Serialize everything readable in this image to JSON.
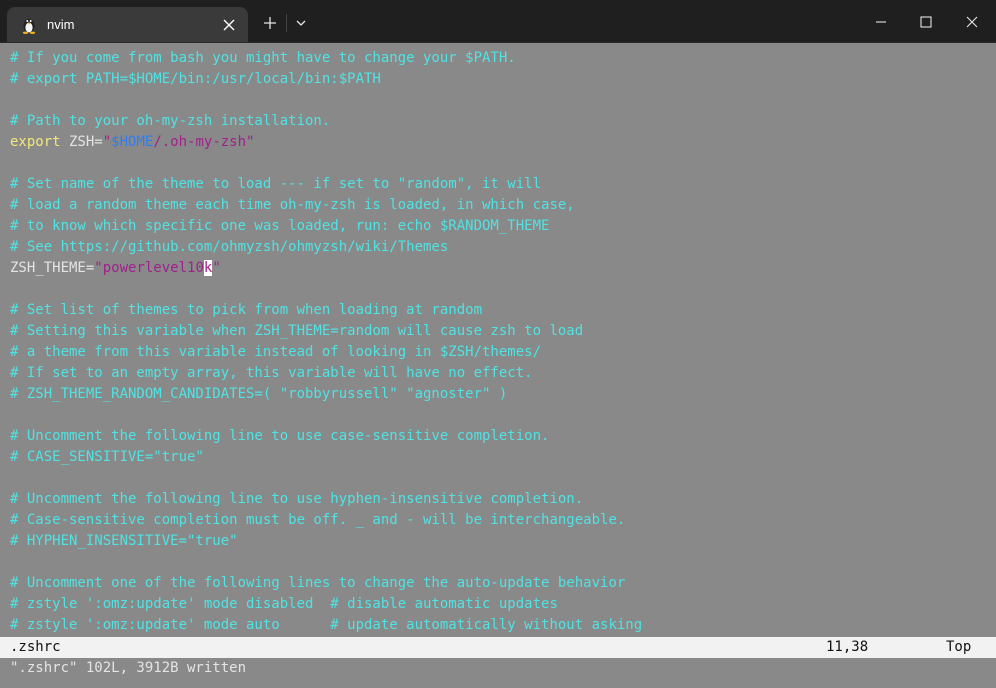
{
  "window": {
    "tab_title": "nvim",
    "icons": {
      "tab": "linux-tux-icon",
      "close_tab": "close-icon",
      "new_tab": "plus-icon",
      "dropdown": "chevron-down-icon",
      "minimize": "minimize-icon",
      "maximize": "maximize-icon",
      "close": "close-icon"
    }
  },
  "editor": {
    "lines": [
      [
        {
          "t": "# If you come from bash you might have to change your $PATH.",
          "k": "c"
        }
      ],
      [
        {
          "t": "# export PATH=$HOME/bin:/usr/local/bin:$PATH",
          "k": "c"
        }
      ],
      [],
      [
        {
          "t": "# Path to your oh-my-zsh installation.",
          "k": "c"
        }
      ],
      [
        {
          "t": "export",
          "k": "kw"
        },
        {
          "t": " ZSH=",
          "k": "pl"
        },
        {
          "t": "\"",
          "k": "str"
        },
        {
          "t": "$HOME",
          "k": "var"
        },
        {
          "t": "/.oh-my-zsh\"",
          "k": "str"
        }
      ],
      [],
      [
        {
          "t": "# Set name of the theme to load --- if set to \"random\", it will",
          "k": "c"
        }
      ],
      [
        {
          "t": "# load a random theme each time oh-my-zsh is loaded, in which case,",
          "k": "c"
        }
      ],
      [
        {
          "t": "# to know which specific one was loaded, run: echo $RANDOM_THEME",
          "k": "c"
        }
      ],
      [
        {
          "t": "# See https://github.com/ohmyzsh/ohmyzsh/wiki/Themes",
          "k": "c"
        }
      ],
      [
        {
          "t": "ZSH_THEME=",
          "k": "pl"
        },
        {
          "t": "\"powerlevel10",
          "k": "str"
        },
        {
          "t": "k",
          "k": "cursor"
        },
        {
          "t": "\"",
          "k": "str"
        }
      ],
      [],
      [
        {
          "t": "# Set list of themes to pick from when loading at random",
          "k": "c"
        }
      ],
      [
        {
          "t": "# Setting this variable when ZSH_THEME=random will cause zsh to load",
          "k": "c"
        }
      ],
      [
        {
          "t": "# a theme from this variable instead of looking in $ZSH/themes/",
          "k": "c"
        }
      ],
      [
        {
          "t": "# If set to an empty array, this variable will have no effect.",
          "k": "c"
        }
      ],
      [
        {
          "t": "# ZSH_THEME_RANDOM_CANDIDATES=( \"robbyrussell\" \"agnoster\" )",
          "k": "c"
        }
      ],
      [],
      [
        {
          "t": "# Uncomment the following line to use case-sensitive completion.",
          "k": "c"
        }
      ],
      [
        {
          "t": "# CASE_SENSITIVE=\"true\"",
          "k": "c"
        }
      ],
      [],
      [
        {
          "t": "# Uncomment the following line to use hyphen-insensitive completion.",
          "k": "c"
        }
      ],
      [
        {
          "t": "# Case-sensitive completion must be off. _ and - will be interchangeable.",
          "k": "c"
        }
      ],
      [
        {
          "t": "# HYPHEN_INSENSITIVE=\"true\"",
          "k": "c"
        }
      ],
      [],
      [
        {
          "t": "# Uncomment one of the following lines to change the auto-update behavior",
          "k": "c"
        }
      ],
      [
        {
          "t": "# zstyle ':omz:update' mode disabled  # disable automatic updates",
          "k": "c"
        }
      ],
      [
        {
          "t": "# zstyle ':omz:update' mode auto      # update automatically without asking",
          "k": "c"
        }
      ]
    ]
  },
  "statusline": {
    "file": ".zshrc",
    "position": "11,38",
    "scroll": "Top"
  },
  "cmdline": "\".zshrc\" 102L, 3912B written",
  "colors": {
    "comment": "#4fe3e3",
    "keyword": "#f3e87a",
    "string": "#a0208c",
    "variable": "#2f7df4",
    "background": "#898989"
  }
}
